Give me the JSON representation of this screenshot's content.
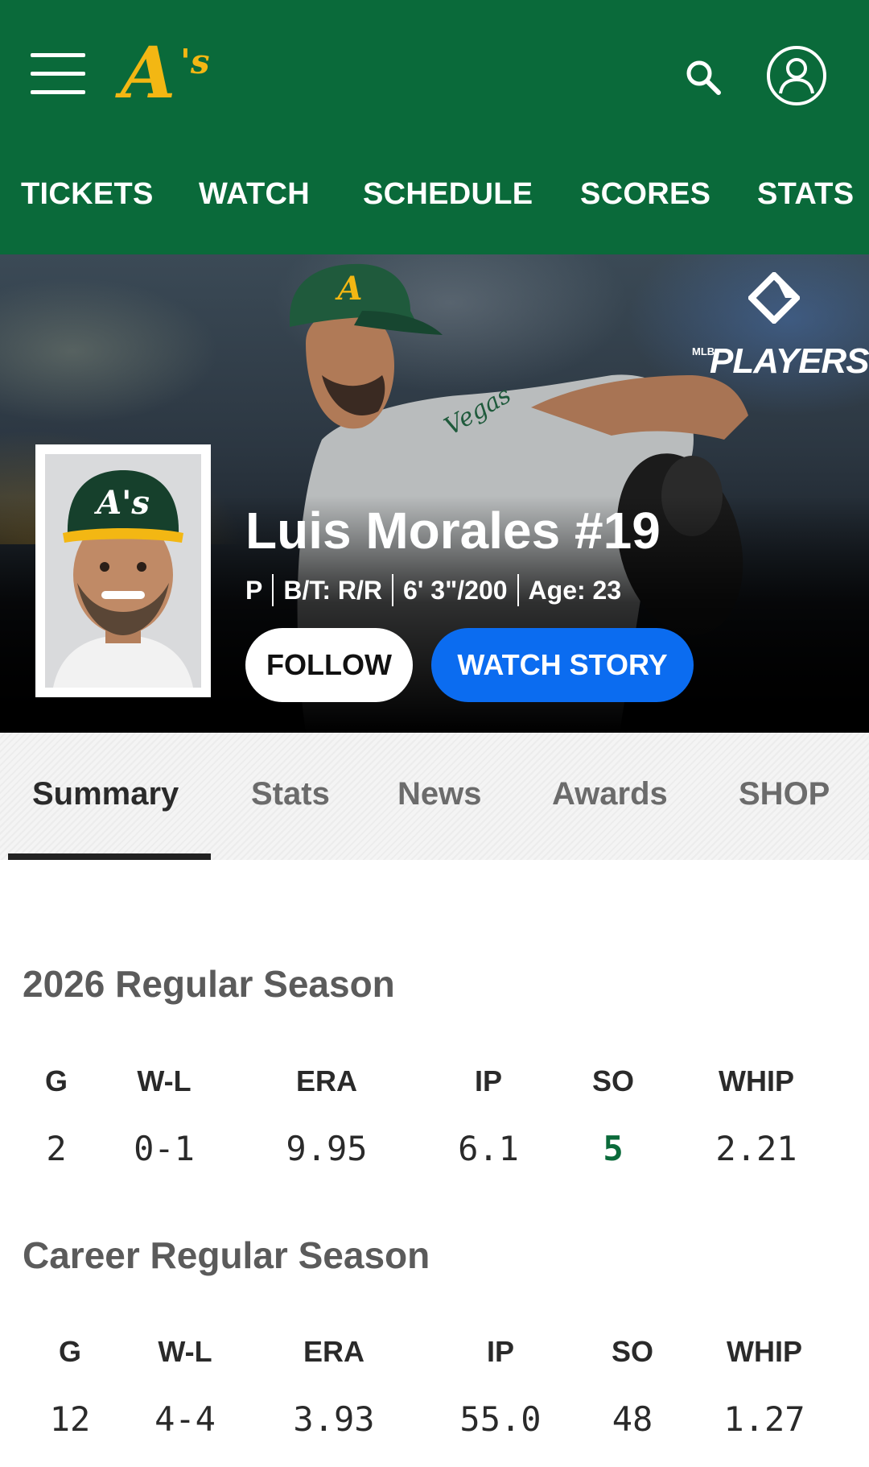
{
  "header": {
    "brand": "A's",
    "brand_color": "#f3b713",
    "bg_color": "#0a6a3a",
    "nav": [
      "TICKETS",
      "WATCH",
      "SCHEDULE",
      "SCORES",
      "STATS"
    ]
  },
  "hero": {
    "badge_text": "PLAYERS",
    "badge_small": "MLB",
    "name": "Luis Morales #19",
    "position": "P",
    "bats_throws": "B/T: R/R",
    "height_weight": "6' 3\"/200",
    "age": "Age: 23",
    "follow_label": "FOLLOW",
    "watch_story_label": "WATCH STORY",
    "watch_color": "#0b6cf0",
    "cap_logo": "A's"
  },
  "tabs": [
    "Summary",
    "Stats",
    "News",
    "Awards",
    "SHOP"
  ],
  "season": {
    "title": "2026 Regular Season",
    "headers": [
      "G",
      "W-L",
      "ERA",
      "IP",
      "SO",
      "WHIP"
    ],
    "values": [
      "2",
      "0-1",
      "9.95",
      "6.1",
      "5",
      "2.21"
    ],
    "highlight_color": "#0a6a3a"
  },
  "career": {
    "title": "Career Regular Season",
    "headers": [
      "G",
      "W-L",
      "ERA",
      "IP",
      "SO",
      "WHIP"
    ],
    "values": [
      "12",
      "4-4",
      "3.93",
      "55.0",
      "48",
      "1.27"
    ]
  }
}
